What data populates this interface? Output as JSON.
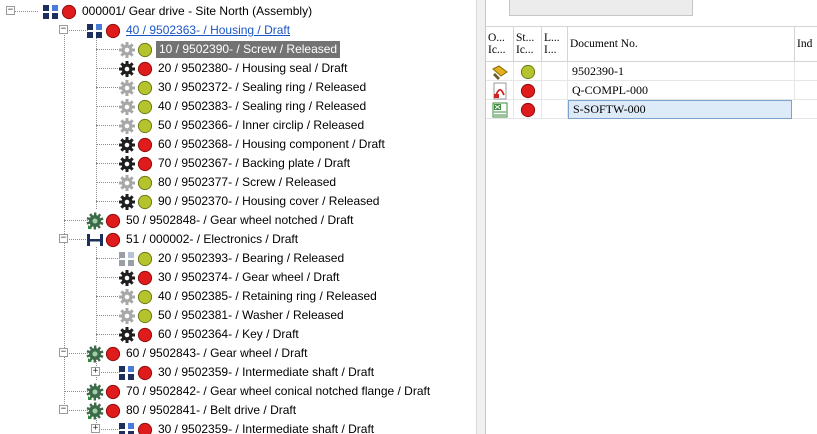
{
  "tree": {
    "rows": [
      {
        "label": "000001/ Gear drive - Site North (Assembly)",
        "icon": "assembly-icon",
        "status": "red",
        "depth": 0,
        "expander": "minus"
      },
      {
        "label": "40 / 9502363- / Housing / Draft",
        "icon": "assembly-icon",
        "status": "red",
        "depth": 1,
        "expander": "minus",
        "style": "link"
      },
      {
        "label": "10 / 9502390- / Screw / Released",
        "icon": "gear-icon-grey",
        "status": "green",
        "depth": 2,
        "style": "selected"
      },
      {
        "label": "20 / 9502380- / Housing seal / Draft",
        "icon": "gear-icon-dark",
        "status": "red",
        "depth": 2
      },
      {
        "label": "30 / 9502372- / Sealing ring / Released",
        "icon": "gear-icon-grey",
        "status": "green",
        "depth": 2
      },
      {
        "label": "40 / 9502383- / Sealing ring / Released",
        "icon": "gear-icon-grey",
        "status": "green",
        "depth": 2
      },
      {
        "label": "50 / 9502366- / Inner circlip / Released",
        "icon": "gear-icon-grey",
        "status": "green",
        "depth": 2
      },
      {
        "label": "60 / 9502368- / Housing component / Draft",
        "icon": "gear-icon-dark",
        "status": "red",
        "depth": 2
      },
      {
        "label": "70 / 9502367- / Backing plate / Draft",
        "icon": "gear-icon-dark",
        "status": "red",
        "depth": 2
      },
      {
        "label": "80 / 9502377- / Screw / Released",
        "icon": "gear-icon-grey",
        "status": "green",
        "depth": 2
      },
      {
        "label": "90 / 9502370- / Housing cover / Released",
        "icon": "gear-icon-dark",
        "status": "green",
        "depth": 2
      },
      {
        "label": "50 / 9502848- / Gear wheel notched / Draft",
        "icon": "gearwheel-icon",
        "status": "red",
        "depth": 1
      },
      {
        "label": "51 / 000002- / Electronics / Draft",
        "icon": "electronics-icon",
        "status": "red",
        "depth": 1,
        "expander": "minus"
      },
      {
        "label": "20 / 9502393- / Bearing / Released",
        "icon": "assembly-icon-grey",
        "status": "green",
        "depth": 2
      },
      {
        "label": "30 / 9502374- / Gear wheel / Draft",
        "icon": "gear-icon-dark",
        "status": "red",
        "depth": 2
      },
      {
        "label": "40 / 9502385- / Retaining ring / Released",
        "icon": "gear-icon-grey",
        "status": "green",
        "depth": 2
      },
      {
        "label": "50 / 9502381- / Washer / Released",
        "icon": "gear-icon-grey",
        "status": "green",
        "depth": 2
      },
      {
        "label": "60 / 9502364- / Key / Draft",
        "icon": "gear-icon-dark",
        "status": "red",
        "depth": 2
      },
      {
        "label": "60 / 9502843- / Gear wheel / Draft",
        "icon": "gearwheel-icon",
        "status": "red",
        "depth": 1,
        "expander": "minus"
      },
      {
        "label": "30 / 9502359- / Intermediate shaft / Draft",
        "icon": "assembly-icon",
        "status": "red",
        "depth": 2,
        "expander": "plus"
      },
      {
        "label": "70 / 9502842- / Gear wheel conical notched flange / Draft",
        "icon": "gearwheel-icon",
        "status": "red",
        "depth": 1
      },
      {
        "label": "80 / 9502841- / Belt drive / Draft",
        "icon": "gearwheel-icon",
        "status": "red",
        "depth": 1,
        "expander": "minus"
      },
      {
        "label": "30 / 9502359- / Intermediate shaft / Draft",
        "icon": "assembly-icon",
        "status": "red",
        "depth": 2,
        "expander": "plus"
      }
    ]
  },
  "documents": {
    "columns": [
      {
        "label": "O... Ic..."
      },
      {
        "label": "St... Ic..."
      },
      {
        "label": "L... I..."
      },
      {
        "label": "Document No."
      },
      {
        "label": "Ind"
      }
    ],
    "rows": [
      {
        "object_icon": "wrench-folder-icon",
        "status": "green",
        "doc_no": "9502390-1"
      },
      {
        "object_icon": "pdf-icon",
        "status": "red",
        "doc_no": "Q-COMPL-000"
      },
      {
        "object_icon": "spreadsheet-icon",
        "status": "red",
        "doc_no": "S-SOFTW-000",
        "active": true
      }
    ]
  },
  "colors": {
    "status_red": "#e01b1b",
    "status_green": "#b5c42d",
    "link": "#1a56c8",
    "selection": "#737373"
  }
}
